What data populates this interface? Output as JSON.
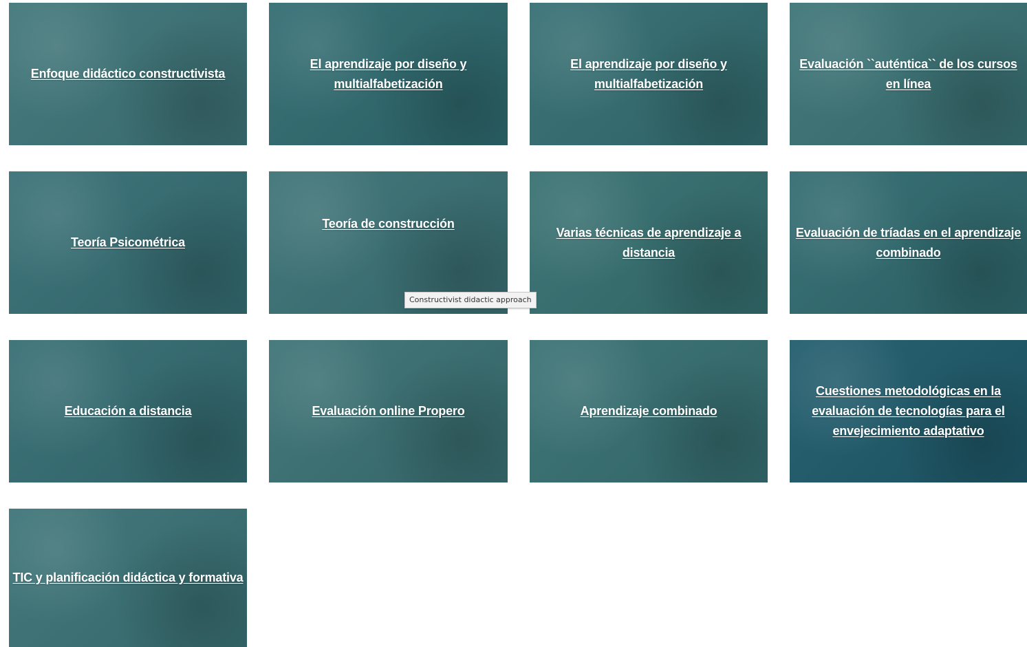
{
  "colors": {
    "overlay": "#2f6b72",
    "overlay_dark": "#1d5a6a",
    "text": "#ffffff"
  },
  "cards": [
    {
      "title": "Enfoque didáctico constructivista"
    },
    {
      "title": "El aprendizaje por diseño y multialfabetización"
    },
    {
      "title": "El aprendizaje por diseño y multialfabetización"
    },
    {
      "title": "Evaluación ``auténtica`` de los cursos en línea"
    },
    {
      "title": "Teoría Psicométrica"
    },
    {
      "title": "Teoría de construcción"
    },
    {
      "title": "Varias técnicas de aprendizaje a distancia"
    },
    {
      "title": "Evaluación de tríadas en el aprendizaje combinado"
    },
    {
      "title": "Educación a distancia"
    },
    {
      "title": "Evaluación online Propero"
    },
    {
      "title": "Aprendizaje combinado"
    },
    {
      "title": "Cuestiones metodológicas en la evaluación de tecnologías para el envejecimiento adaptativo"
    },
    {
      "title": "TIC y planificación didáctica y formativa"
    }
  ],
  "tooltip": {
    "text": "Constructivist didactic approach"
  }
}
